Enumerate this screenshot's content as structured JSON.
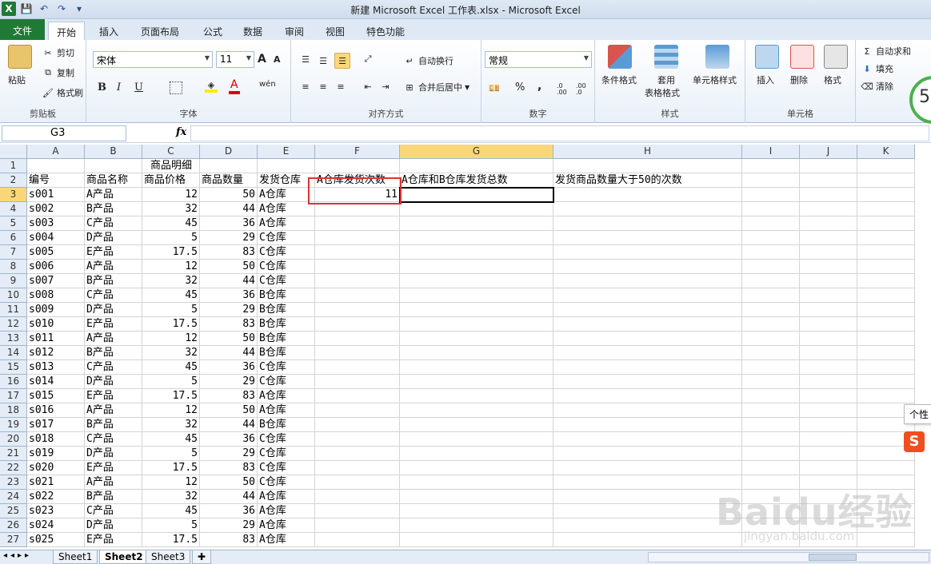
{
  "window": {
    "title": "新建 Microsoft Excel 工作表.xlsx - Microsoft Excel",
    "logo_letter": "X"
  },
  "qat": {
    "save": "💾",
    "undo": "↶",
    "redo": "↷",
    "customize": "▾"
  },
  "tabs": [
    "文件",
    "开始",
    "插入",
    "页面布局",
    "公式",
    "数据",
    "审阅",
    "视图",
    "特色功能"
  ],
  "ribbon": {
    "clipboard": {
      "paste": "粘贴",
      "cut": "剪切",
      "copy": "复制",
      "format_painter": "格式刷",
      "label": "剪贴板"
    },
    "font": {
      "name": "宋体",
      "size": "11",
      "grow": "A",
      "shrink": "A",
      "bold": "B",
      "italic": "I",
      "underline": "U",
      "phonetic": "wén",
      "label": "字体"
    },
    "alignment": {
      "wrap": "自动换行",
      "merge": "合并后居中",
      "label": "对齐方式"
    },
    "number": {
      "format": "常规",
      "percent": "%",
      "comma": ",",
      "inc_decimal": ".0 .00",
      "dec_decimal": ".00 .0",
      "label": "数字"
    },
    "styles": {
      "conditional": "条件格式",
      "table1": "套用",
      "table2": "表格格式",
      "cell_styles": "单元格样式",
      "label": "样式"
    },
    "cells": {
      "insert": "插入",
      "delete": "删除",
      "format": "格式",
      "label": "单元格"
    },
    "editing": {
      "autosum": "自动求和",
      "fill": "填充",
      "clear": "清除"
    }
  },
  "formula_bar": {
    "name_box": "G3",
    "fx": "fx",
    "value": ""
  },
  "columns": [
    "A",
    "B",
    "C",
    "D",
    "E",
    "F",
    "G",
    "H",
    "I",
    "J",
    "K"
  ],
  "row_numbers": [
    "1",
    "2",
    "3",
    "4",
    "5",
    "6",
    "7",
    "8",
    "9",
    "10",
    "11",
    "12",
    "13",
    "14",
    "15",
    "16",
    "17",
    "18",
    "19",
    "20",
    "21",
    "22",
    "23",
    "24",
    "25",
    "26",
    "27"
  ],
  "sheet": {
    "title_C1": "商品明细",
    "headers": [
      "编号",
      "商品名称",
      "商品价格",
      "商品数量",
      "发货仓库",
      "A仓库发货次数",
      "A仓库和B仓库发货总数",
      "发货商品数量大于50的次数"
    ],
    "f3_value": "11",
    "rows": [
      [
        "s001",
        "A产品",
        "12",
        "50",
        "A仓库"
      ],
      [
        "s002",
        "B产品",
        "32",
        "44",
        "A仓库"
      ],
      [
        "s003",
        "C产品",
        "45",
        "36",
        "A仓库"
      ],
      [
        "s004",
        "D产品",
        "5",
        "29",
        "C仓库"
      ],
      [
        "s005",
        "E产品",
        "17.5",
        "83",
        "C仓库"
      ],
      [
        "s006",
        "A产品",
        "12",
        "50",
        "C仓库"
      ],
      [
        "s007",
        "B产品",
        "32",
        "44",
        "C仓库"
      ],
      [
        "s008",
        "C产品",
        "45",
        "36",
        "B仓库"
      ],
      [
        "s009",
        "D产品",
        "5",
        "29",
        "B仓库"
      ],
      [
        "s010",
        "E产品",
        "17.5",
        "83",
        "B仓库"
      ],
      [
        "s011",
        "A产品",
        "12",
        "50",
        "B仓库"
      ],
      [
        "s012",
        "B产品",
        "32",
        "44",
        "B仓库"
      ],
      [
        "s013",
        "C产品",
        "45",
        "36",
        "C仓库"
      ],
      [
        "s014",
        "D产品",
        "5",
        "29",
        "C仓库"
      ],
      [
        "s015",
        "E产品",
        "17.5",
        "83",
        "A仓库"
      ],
      [
        "s016",
        "A产品",
        "12",
        "50",
        "A仓库"
      ],
      [
        "s017",
        "B产品",
        "32",
        "44",
        "B仓库"
      ],
      [
        "s018",
        "C产品",
        "45",
        "36",
        "C仓库"
      ],
      [
        "s019",
        "D产品",
        "5",
        "29",
        "C仓库"
      ],
      [
        "s020",
        "E产品",
        "17.5",
        "83",
        "C仓库"
      ],
      [
        "s021",
        "A产品",
        "12",
        "50",
        "C仓库"
      ],
      [
        "s022",
        "B产品",
        "32",
        "44",
        "A仓库"
      ],
      [
        "s023",
        "C产品",
        "45",
        "36",
        "A仓库"
      ],
      [
        "s024",
        "D产品",
        "5",
        "29",
        "A仓库"
      ],
      [
        "s025",
        "E产品",
        "17.5",
        "83",
        "A仓库"
      ]
    ]
  },
  "sheet_tabs": [
    "Sheet1",
    "Sheet2",
    "Sheet3"
  ],
  "overlays": {
    "tooltip": "个性",
    "sogou": "S",
    "ring_value": "5",
    "watermark": "Baidu经验",
    "watermark_url": "jingyan.baidu.com"
  },
  "colors": {
    "file_tab": "#1f7a36",
    "highlight_box": "#e03131",
    "selected_header": "#f9d778"
  }
}
